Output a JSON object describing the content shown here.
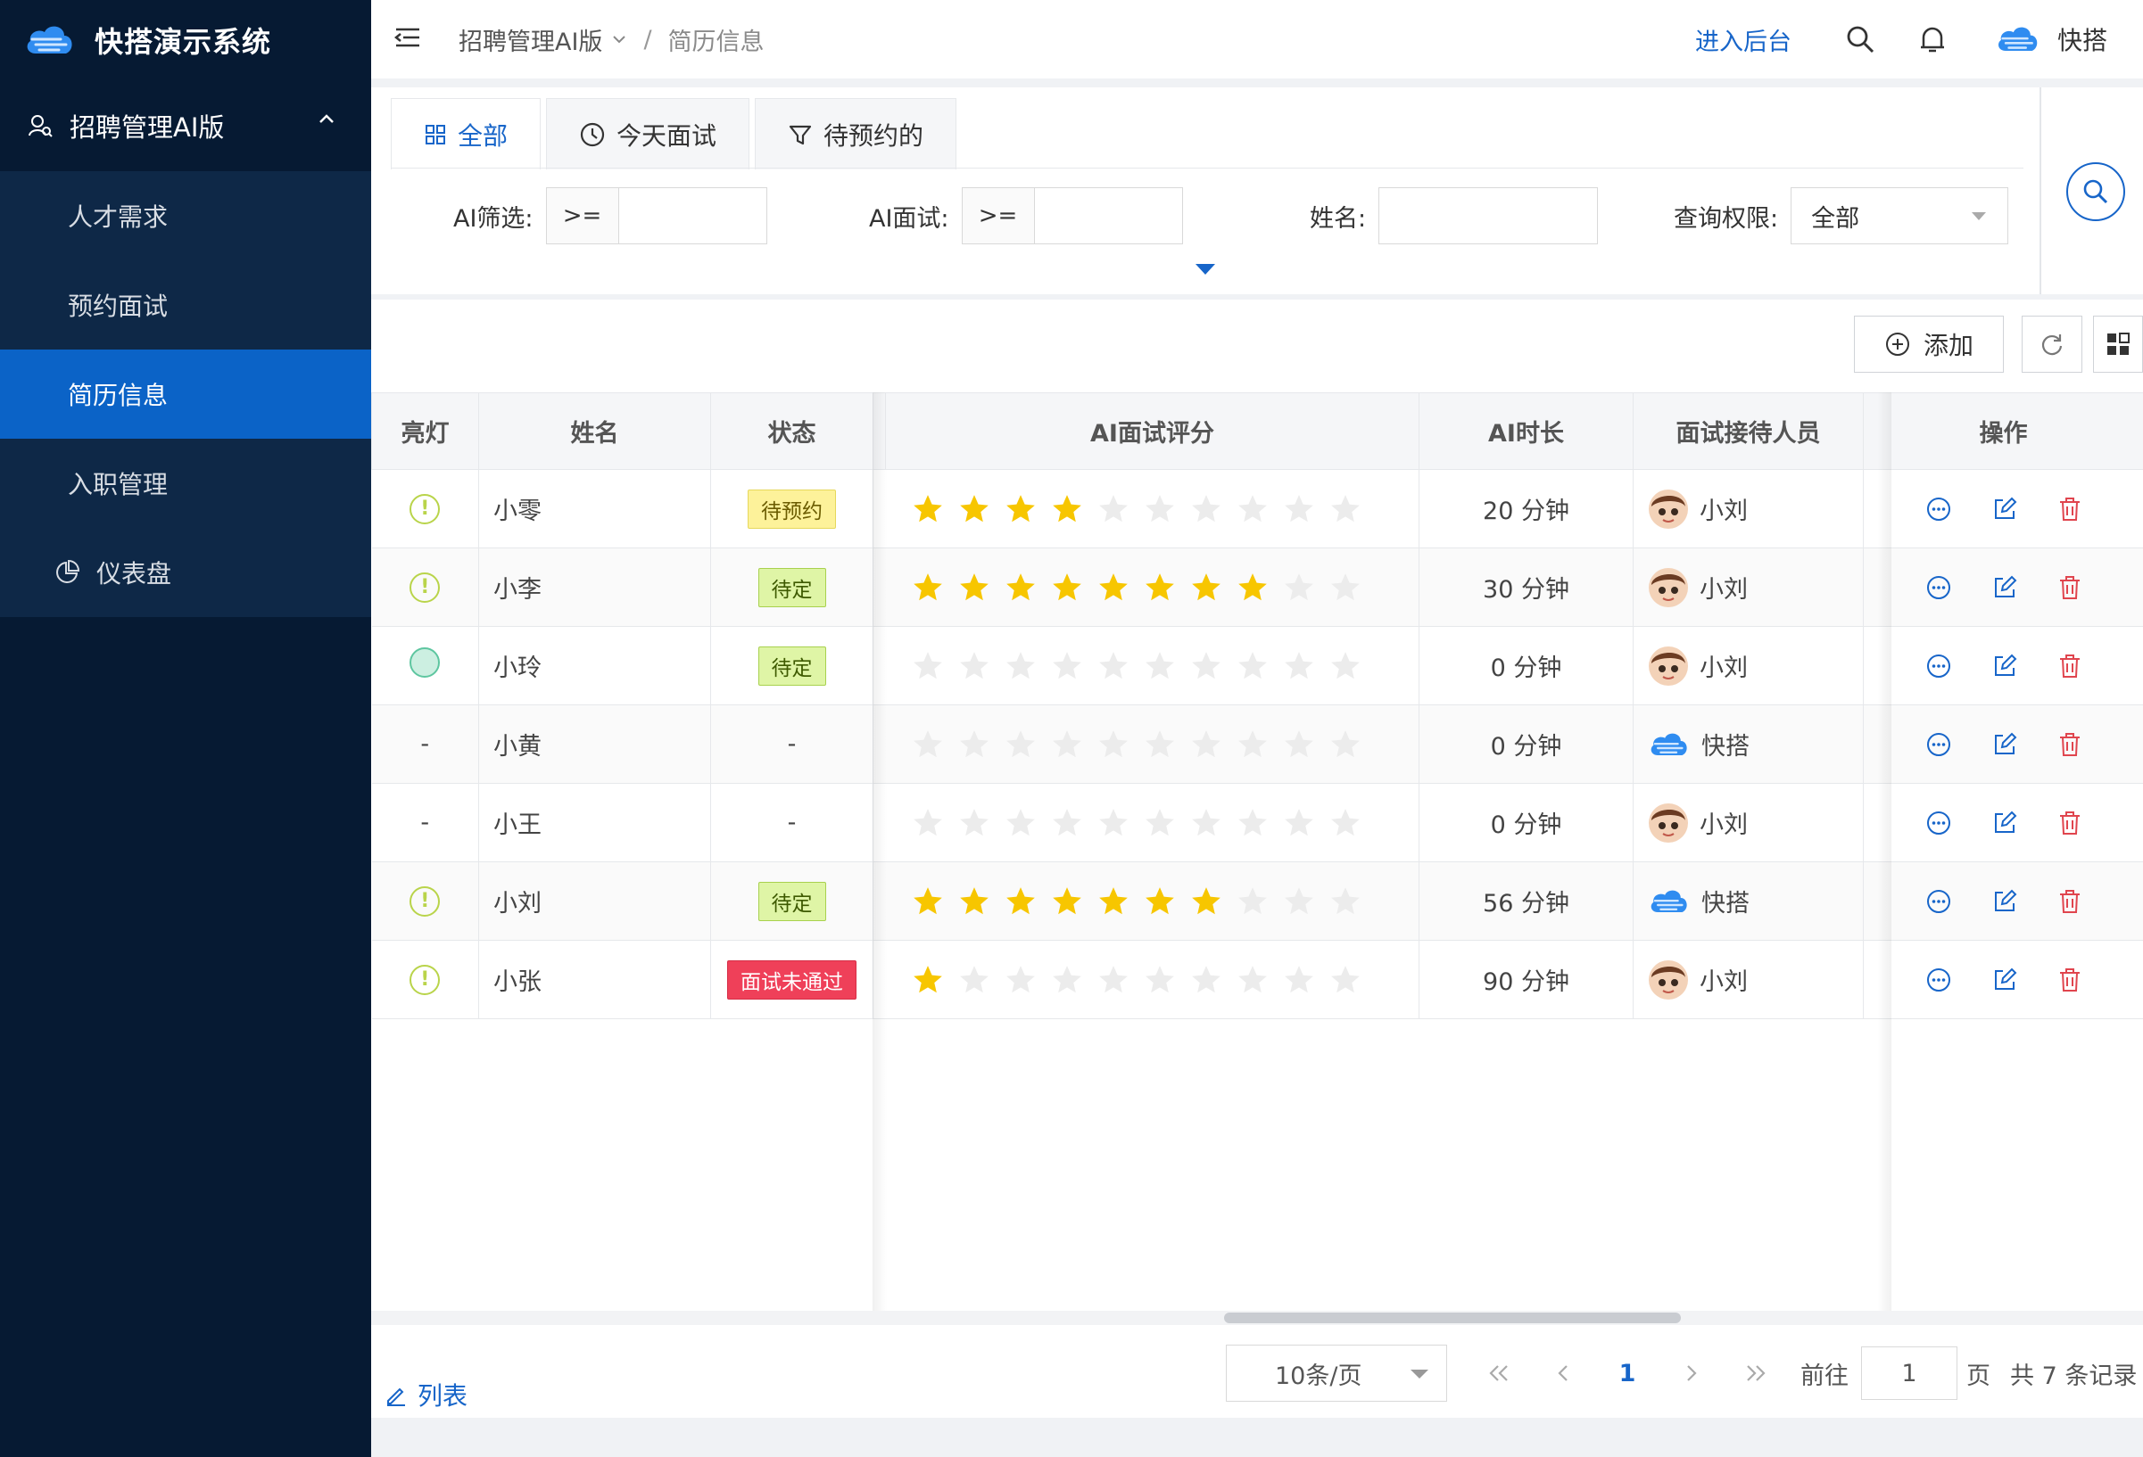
{
  "app": {
    "title": "快搭演示系统"
  },
  "sidebar": {
    "group_label": "招聘管理AI版",
    "items": [
      {
        "label": "人才需求",
        "active": false
      },
      {
        "label": "预约面试",
        "active": false
      },
      {
        "label": "简历信息",
        "active": true
      },
      {
        "label": "入职管理",
        "active": false
      }
    ],
    "dashboard_label": "仪表盘"
  },
  "header": {
    "breadcrumb_parent": "招聘管理AI版",
    "breadcrumb_sep": "/",
    "breadcrumb_current": "简历信息",
    "backend_link": "进入后台",
    "user_name": "快搭"
  },
  "tabs": [
    {
      "label": "全部",
      "icon": "grid-icon",
      "active": true
    },
    {
      "label": "今天面试",
      "icon": "clock-icon",
      "active": false
    },
    {
      "label": "待预约的",
      "icon": "filter-icon",
      "active": false
    }
  ],
  "filters": {
    "ai_screen_label": "AI筛选:",
    "ai_screen_op": ">=",
    "ai_screen_value": "",
    "ai_interview_label": "AI面试:",
    "ai_interview_op": ">=",
    "ai_interview_value": "",
    "name_label": "姓名:",
    "name_value": "",
    "scope_label": "查询权限:",
    "scope_value": "全部"
  },
  "toolbar": {
    "add_label": "添加"
  },
  "table": {
    "columns": [
      "亮灯",
      "姓名",
      "状态",
      "AI面试评分",
      "AI时长",
      "面试接待人员",
      "操作"
    ],
    "star_max": 10,
    "rows": [
      {
        "lamp": "yellow",
        "lamp_text": "!",
        "name": "小零",
        "status": "待预约",
        "status_color": "yellow",
        "stars": 4,
        "duration": "20 分钟",
        "receptionist": "小刘",
        "avatar": "boy-avatar"
      },
      {
        "lamp": "yellow",
        "lamp_text": "!",
        "name": "小李",
        "status": "待定",
        "status_color": "green",
        "stars": 8,
        "duration": "30 分钟",
        "receptionist": "小刘",
        "avatar": "boy-avatar"
      },
      {
        "lamp": "green",
        "lamp_text": "",
        "name": "小玲",
        "status": "待定",
        "status_color": "green",
        "stars": 0,
        "duration": "0 分钟",
        "receptionist": "小刘",
        "avatar": "boy-avatar"
      },
      {
        "lamp": "none",
        "lamp_text": "-",
        "name": "小黄",
        "status": "-",
        "status_color": "none",
        "stars": 0,
        "duration": "0 分钟",
        "receptionist": "快搭",
        "avatar": "cloud-logo"
      },
      {
        "lamp": "none",
        "lamp_text": "-",
        "name": "小王",
        "status": "-",
        "status_color": "none",
        "stars": 0,
        "duration": "0 分钟",
        "receptionist": "小刘",
        "avatar": "boy-avatar"
      },
      {
        "lamp": "yellow",
        "lamp_text": "!",
        "name": "小刘",
        "status": "待定",
        "status_color": "green",
        "stars": 7,
        "duration": "56 分钟",
        "receptionist": "快搭",
        "avatar": "cloud-logo"
      },
      {
        "lamp": "yellow",
        "lamp_text": "!",
        "name": "小张",
        "status": "面试未通过",
        "status_color": "red",
        "stars": 1,
        "duration": "90 分钟",
        "receptionist": "小刘",
        "avatar": "boy-avatar"
      }
    ]
  },
  "footer": {
    "list_label": "列表",
    "page_size": "10条/页",
    "current_page": "1",
    "goto_prefix": "前往",
    "goto_value": "1",
    "goto_suffix": "页",
    "total_text": "共 7 条记录"
  },
  "colors": {
    "sidebar_bg": "#061a33",
    "active_item": "#0b63c7",
    "accent": "#1765c9",
    "star_on": "#f7c600",
    "star_off": "#ececec",
    "delete_red": "#e0454e"
  }
}
